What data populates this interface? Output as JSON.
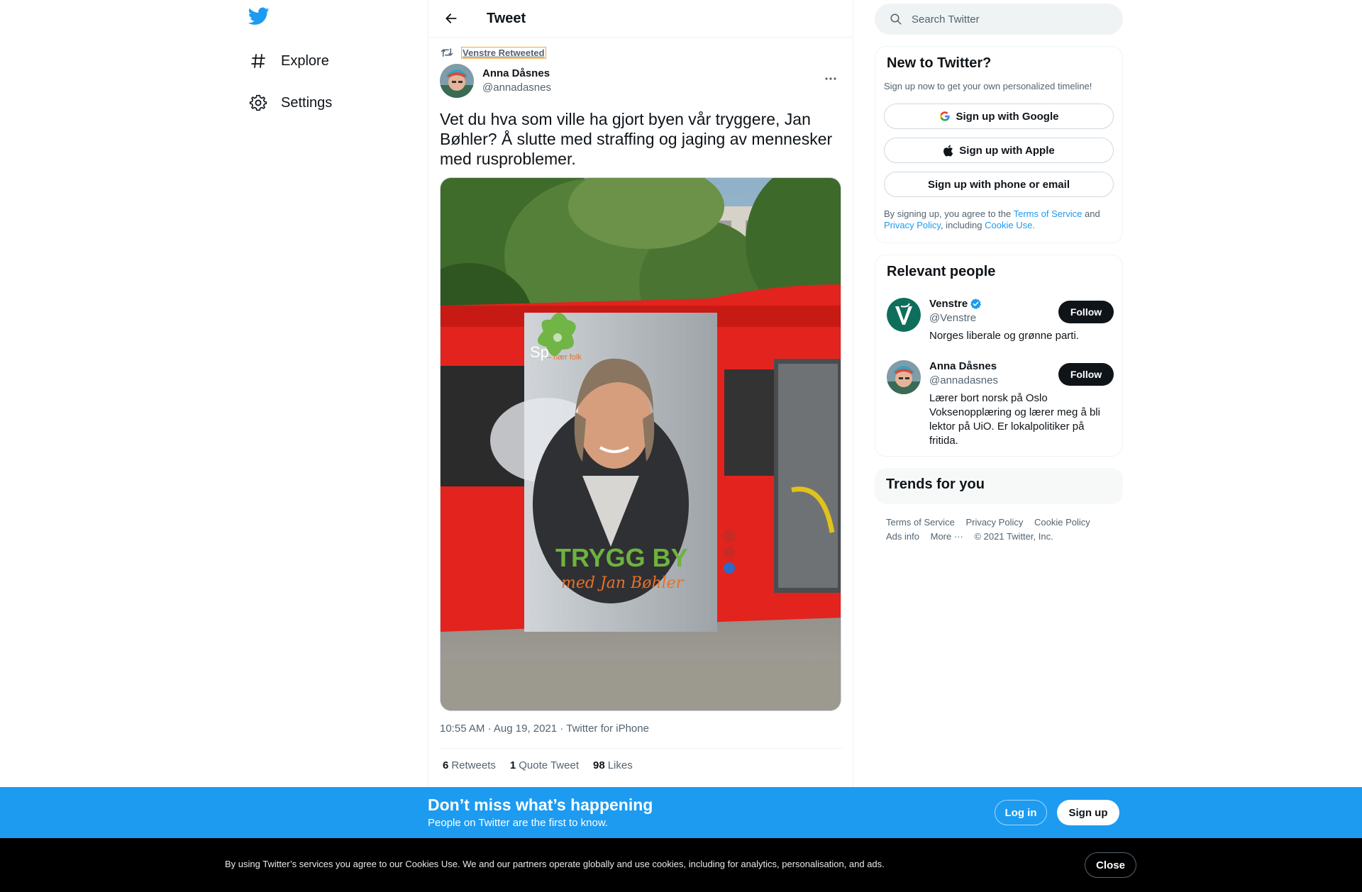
{
  "nav": {
    "items": [
      {
        "label": "Explore",
        "icon": "hashtag-icon"
      },
      {
        "label": "Settings",
        "icon": "gear-icon"
      }
    ]
  },
  "header": {
    "title": "Tweet"
  },
  "tweet": {
    "retweet_context": "Venstre Retweeted",
    "author_name": "Anna Dåsnes",
    "author_handle": "@annadasnes",
    "text": "Vet du hva som ville ha gjort byen vår tryggere, Jan Bøhler? Å slutte med straffing og jaging av mennesker med rusproblemer.",
    "poster_headline": "TRYGG BY",
    "poster_subline": "med Jan Bøhler",
    "poster_logo": "Sp",
    "poster_logo_tag": "– nær folk",
    "time": "10:55 AM",
    "date": "Aug 19, 2021",
    "source": "Twitter for iPhone",
    "stats": [
      {
        "num": "6",
        "label": "Retweets"
      },
      {
        "num": "1",
        "label": "Quote Tweet"
      },
      {
        "num": "98",
        "label": "Likes"
      }
    ]
  },
  "search": {
    "placeholder": "Search Twitter"
  },
  "signup": {
    "title": "New to Twitter?",
    "subtitle": "Sign up now to get your own personalized timeline!",
    "google_label": "Sign up with Google",
    "apple_label": "Sign up with Apple",
    "phone_label": "Sign up with phone or email",
    "legal_prefix": "By signing up, you agree to the ",
    "terms": "Terms of Service",
    "and": " and ",
    "privacy": "Privacy Policy",
    "including": ", including ",
    "cookie": "Cookie Use."
  },
  "relevant": {
    "title": "Relevant people",
    "people": [
      {
        "name": "Venstre",
        "handle": "@Venstre",
        "bio": "Norges liberale og grønne parti.",
        "follow": "Follow",
        "verified": true
      },
      {
        "name": "Anna Dåsnes",
        "handle": "@annadasnes",
        "bio": "Lærer bort norsk på Oslo Voksenopplæring og lærer meg å bli lektor på UiO. Er lokalpolitiker på fritida.",
        "follow": "Follow",
        "verified": false
      }
    ]
  },
  "trends": {
    "title": "Trends for you"
  },
  "footer": {
    "links": [
      "Terms of Service",
      "Privacy Policy",
      "Cookie Policy",
      "Ads info",
      "More ···"
    ],
    "copyright": "© 2021 Twitter, Inc."
  },
  "bottom_bar": {
    "title": "Don’t miss what’s happening",
    "subtitle": "People on Twitter are the first to know.",
    "login": "Log in",
    "signup": "Sign up"
  },
  "cookie_bar": {
    "text": "By using Twitter’s services you agree to our Cookies Use. We and our partners operate globally and use cookies, including for analytics, personalisation, and ads.",
    "close": "Close"
  },
  "colors": {
    "brand": "#1d9bf0",
    "text": "#0f1419",
    "muted": "#536471",
    "bus_red": "#e3231d",
    "poster_green": "#6db33f"
  }
}
